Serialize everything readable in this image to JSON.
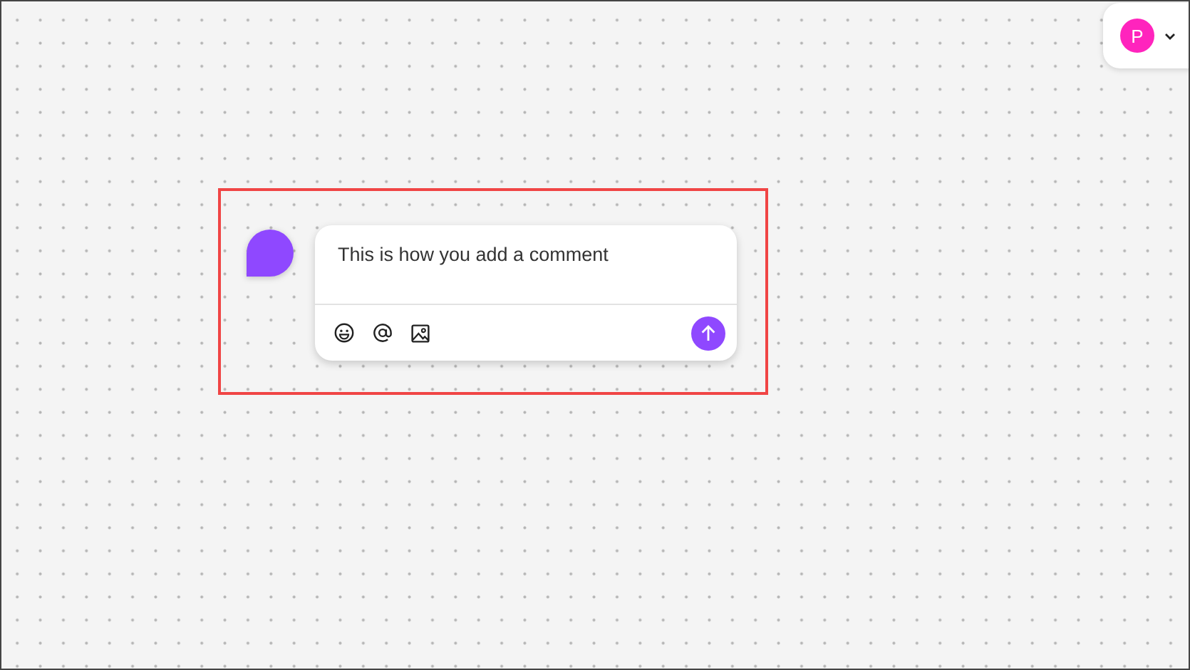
{
  "user_menu": {
    "avatar_letter": "P"
  },
  "comment": {
    "value": "This is how you add a comment"
  }
}
